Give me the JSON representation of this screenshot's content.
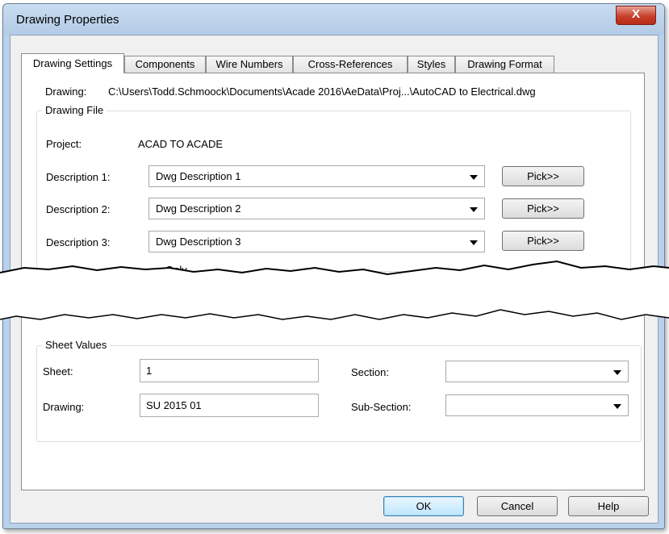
{
  "window": {
    "title": "Drawing Properties",
    "close_glyph": "X"
  },
  "tabs": [
    {
      "label": "Drawing Settings",
      "active": true
    },
    {
      "label": "Components",
      "active": false
    },
    {
      "label": "Wire Numbers",
      "active": false
    },
    {
      "label": "Cross-References",
      "active": false
    },
    {
      "label": "Styles",
      "active": false
    },
    {
      "label": "Drawing Format",
      "active": false
    }
  ],
  "drawing_path": {
    "label": "Drawing:",
    "value": "C:\\Users\\Todd.Schmoock\\Documents\\Acade 2016\\AeData\\Proj...\\AutoCAD to Electrical.dwg"
  },
  "drawing_file": {
    "title": "Drawing File",
    "project_label": "Project:",
    "project_value": "ACAD TO ACADE",
    "descriptions": [
      {
        "label": "Description 1:",
        "value": "Dwg Description 1",
        "button": "Pick>>"
      },
      {
        "label": "Description 2:",
        "value": "Dwg Description 2",
        "button": "Pick>>"
      },
      {
        "label": "Description 3:",
        "value": "Dwg Description 3",
        "button": "Pick>>"
      }
    ],
    "partial_text": "Only"
  },
  "sheet_values": {
    "title": "Sheet Values",
    "sheet_label": "Sheet:",
    "sheet_value": "1",
    "drawing_label": "Drawing:",
    "drawing_value": "SU 2015 01",
    "section_label": "Section:",
    "section_value": "",
    "subsection_label": "Sub-Section:",
    "subsection_value": ""
  },
  "footer": {
    "ok": "OK",
    "cancel": "Cancel",
    "help": "Help"
  },
  "colors": {
    "window_frame": "#b9d1ea",
    "close_button": "#c7402c",
    "dialog_bg": "#f0f0f0",
    "default_button": "#bee6fd"
  }
}
